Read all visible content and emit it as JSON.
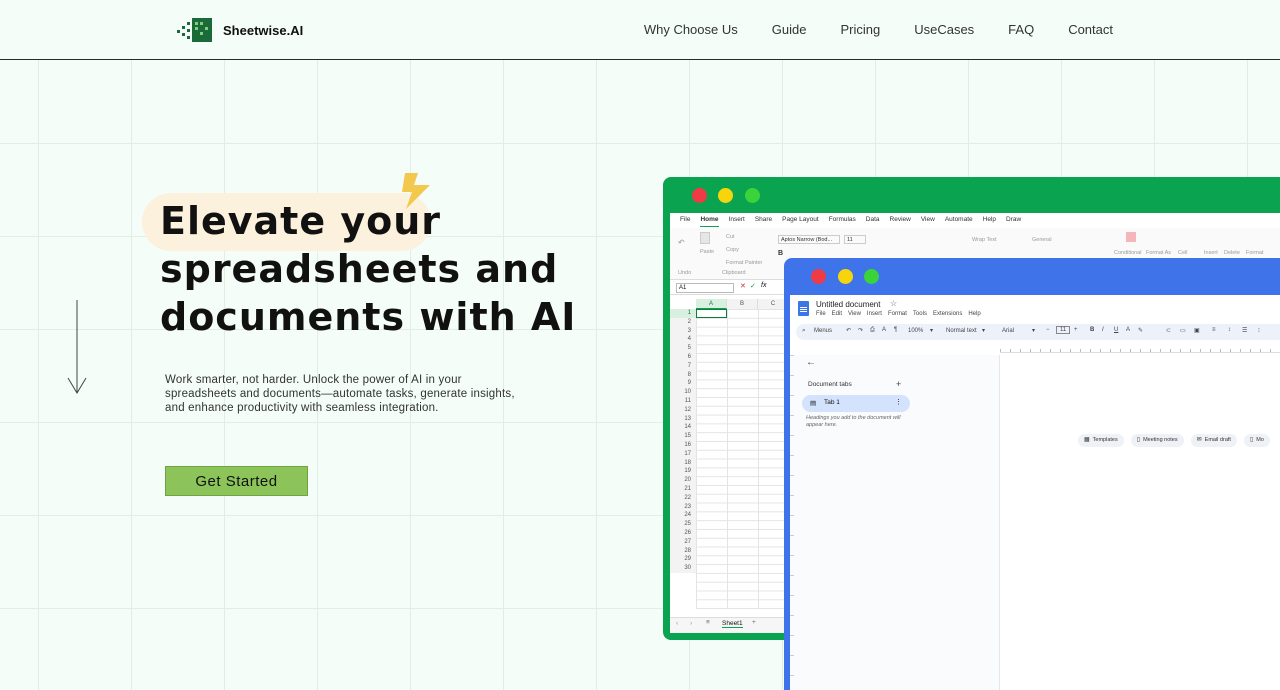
{
  "brand": {
    "name": "Sheetwise.AI",
    "logo_color": "#1a6a3a"
  },
  "nav": [
    "Why Choose Us",
    "Guide",
    "Pricing",
    "UseCases",
    "FAQ",
    "Contact"
  ],
  "hero": {
    "title_line1": "Elevate your",
    "title_line2": "spreadsheets and",
    "title_line3": "documents with AI",
    "subtitle": "Work smarter, not harder. Unlock the power of AI in your spreadsheets and documents—automate tasks, generate insights, and enhance productivity with seamless integration.",
    "cta_label": "Get Started",
    "cta_color": "#8cc459",
    "highlight_color": "#fbf1dd",
    "accent_icon": "lightning-bolt-icon"
  },
  "excel_window": {
    "frame_color": "#0aa34f",
    "menu": [
      "File",
      "Home",
      "Insert",
      "Share",
      "Page Layout",
      "Formulas",
      "Data",
      "Review",
      "View",
      "Automate",
      "Help",
      "Draw"
    ],
    "active_menu": "Home",
    "ribbon": {
      "undo": "Undo",
      "paste": "Paste",
      "clipboard": "Clipboard",
      "cut": "Cut",
      "copy": "Copy",
      "format_painter": "Format Painter",
      "font": "Aptos Narrow (Bod...",
      "font_size": "11",
      "wrap_text": "Wrap Text",
      "number_format": "General",
      "conditional": "Conditional",
      "format_as": "Format As",
      "cell": "Cell",
      "insert": "Insert",
      "delete": "Delete",
      "format": "Format"
    },
    "name_box": "A1",
    "columns": [
      "A",
      "B",
      "C"
    ],
    "rows": [
      "1",
      "2",
      "3",
      "4",
      "5",
      "6",
      "7",
      "8",
      "9",
      "10",
      "11",
      "12",
      "13",
      "14",
      "15",
      "16",
      "17",
      "18",
      "19",
      "20",
      "21",
      "22",
      "23",
      "24",
      "25",
      "26",
      "27",
      "28",
      "29",
      "30"
    ],
    "sheet_tab": "Sheet1"
  },
  "docs_window": {
    "frame_color": "#3f73ea",
    "doc_title": "Untitled document",
    "menu": [
      "File",
      "Edit",
      "View",
      "Insert",
      "Format",
      "Tools",
      "Extensions",
      "Help"
    ],
    "toolbar": {
      "menus": "Menus",
      "zoom": "100%",
      "style": "Normal text",
      "font": "Arial",
      "font_size": "11"
    },
    "sidebar": {
      "heading": "Document tabs",
      "tab": "Tab 1",
      "hint": "Headings you add to the document will appear here."
    },
    "chips": [
      "Templates",
      "Meeting notes",
      "Email draft",
      "Mo"
    ]
  }
}
